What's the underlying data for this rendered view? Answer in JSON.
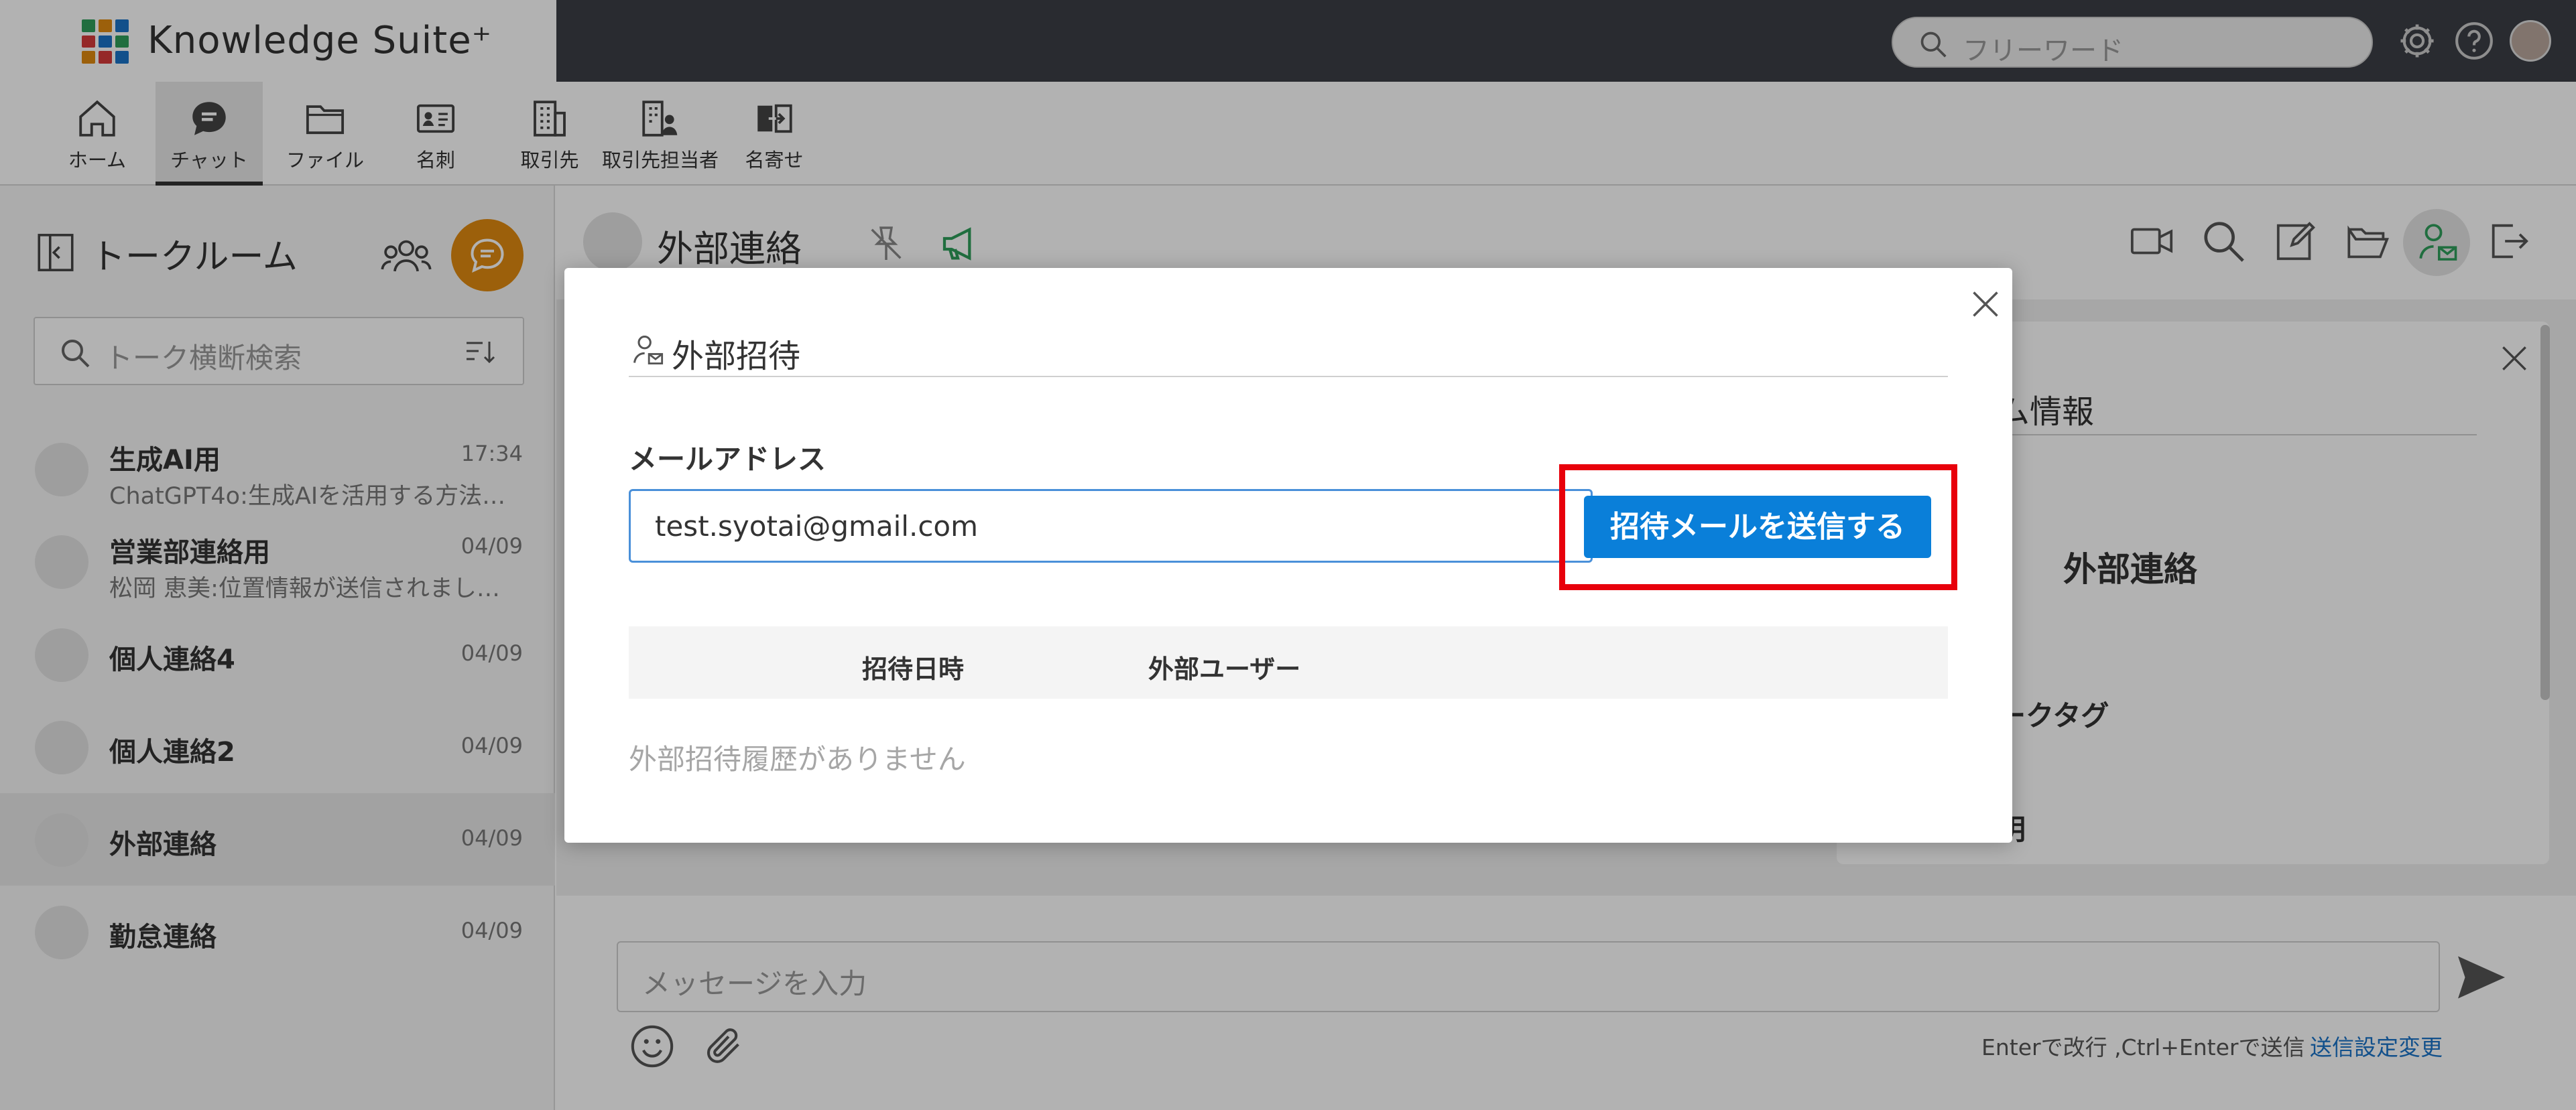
{
  "header": {
    "app_name": "Knowledge Suite⁺",
    "search_placeholder": "フリーワード"
  },
  "menu": [
    {
      "label": "ホーム",
      "icon": "home-icon"
    },
    {
      "label": "チャット",
      "icon": "chat-icon"
    },
    {
      "label": "ファイル",
      "icon": "folder-icon"
    },
    {
      "label": "名刺",
      "icon": "business-card-icon"
    },
    {
      "label": "取引先",
      "icon": "building-icon"
    },
    {
      "label": "取引先担当者",
      "icon": "building-person-icon"
    },
    {
      "label": "名寄せ",
      "icon": "merge-icon"
    }
  ],
  "sidebar": {
    "title": "トークルーム",
    "search_placeholder": "トーク横断検索",
    "rooms": [
      {
        "name": "生成AI用",
        "date": "17:34",
        "preview": "ChatGPT4o:生成AIを活用する方法…"
      },
      {
        "name": "営業部連絡用",
        "date": "04/09",
        "preview": "松岡 恵美:位置情報が送信されまし…"
      },
      {
        "name": "個人連絡4",
        "date": "04/09",
        "preview": ""
      },
      {
        "name": "個人連絡2",
        "date": "04/09",
        "preview": ""
      },
      {
        "name": "外部連絡",
        "date": "04/09",
        "preview": ""
      },
      {
        "name": "勤怠連絡",
        "date": "04/09",
        "preview": ""
      }
    ]
  },
  "main": {
    "room_title": "外部連絡",
    "info_panel": {
      "heading": "ム情報",
      "room_name": "外部連絡",
      "tag_label": "ークタグ",
      "desc_label": "明"
    },
    "message_placeholder": "メッセージを入力",
    "send_hint": "Enterで改行 ,Ctrl+Enterで送信",
    "send_settings_link": "送信設定変更"
  },
  "modal": {
    "title": "外部招待",
    "email_label": "メールアドレス",
    "email_value": "test.syotai@gmail.com",
    "send_button": "招待メールを送信する",
    "columns": [
      "招待日時",
      "外部ユーザー"
    ],
    "empty_text": "外部招待履歴がありません"
  },
  "colors": {
    "header_bg": "#3c3e45",
    "primary_button": "#0a7fd9",
    "highlight_frame": "#e8000b",
    "chat_fab": "#e08a10",
    "accent_green": "#2e9e5b"
  }
}
